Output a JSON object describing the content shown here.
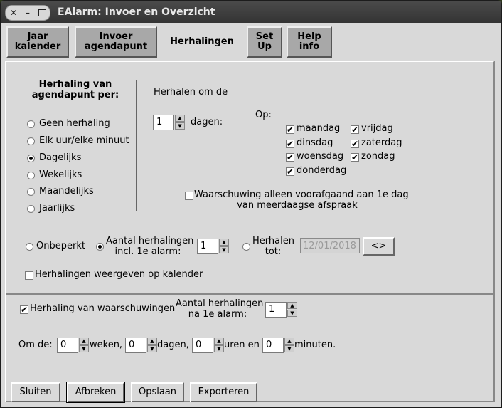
{
  "window": {
    "title": "EAlarm: Invoer en Overzicht",
    "controls": {
      "close": "✕",
      "minimize": "–"
    }
  },
  "tabs": [
    {
      "line1": "Jaar",
      "line2": "kalender",
      "active": false
    },
    {
      "line1": "Invoer",
      "line2": "agendapunt",
      "active": false
    },
    {
      "line1": "Herhalingen",
      "line2": "",
      "active": true
    },
    {
      "line1": "Set",
      "line2": "Up",
      "active": false
    },
    {
      "line1": "Help",
      "line2": "info",
      "active": false
    }
  ],
  "repeat_type": {
    "heading_line1": "Herhaling van",
    "heading_line2": "agendapunt per:",
    "options": [
      "Geen herhaling",
      "Elk uur/elke minuut",
      "Dagelijks",
      "Wekelijks",
      "Maandelijks",
      "Jaarlijks"
    ],
    "selected": "Dagelijks"
  },
  "interval": {
    "label": "Herhalen om de",
    "value": "1",
    "unit": "dagen:"
  },
  "days": {
    "label": "Op:",
    "items": [
      {
        "name": "maandag",
        "checked": true
      },
      {
        "name": "dinsdag",
        "checked": true
      },
      {
        "name": "woensdag",
        "checked": true
      },
      {
        "name": "donderdag",
        "checked": true
      },
      {
        "name": "vrijdag",
        "checked": true
      },
      {
        "name": "zaterdag",
        "checked": true
      },
      {
        "name": "zondag",
        "checked": true
      }
    ]
  },
  "warning_first_day": {
    "checked": false,
    "line1": "Waarschuwing alleen voorafgaand aan 1e dag",
    "line2": "van meerdaagse afspraak"
  },
  "limit": {
    "unlimited_label": "Onbeperkt",
    "count_label_line1": "Aantal herhalingen",
    "count_label_line2": "incl. 1e alarm:",
    "count_value": "1",
    "until_label_line1": "Herhalen",
    "until_label_line2": "tot:",
    "until_date": "12/01/2018",
    "date_button": "<>",
    "selected": "count"
  },
  "show_on_calendar": {
    "checked": false,
    "label": "Herhalingen weergeven op kalender"
  },
  "warning_repeat": {
    "checked": true,
    "label": "Herhaling van waarschuwingen",
    "count_label_line1": "Aantal herhalingen",
    "count_label_line2": "na 1e alarm:",
    "count_value": "1",
    "every_label": "Om de:",
    "weeks_value": "0",
    "weeks_label": "weken,",
    "days_value": "0",
    "days_label": "dagen,",
    "hours_value": "0",
    "hours_label": "uren en",
    "minutes_value": "0",
    "minutes_label": "minuten."
  },
  "buttons": {
    "close": "Sluiten",
    "cancel": "Afbreken",
    "save": "Opslaan",
    "export": "Exporteren"
  }
}
